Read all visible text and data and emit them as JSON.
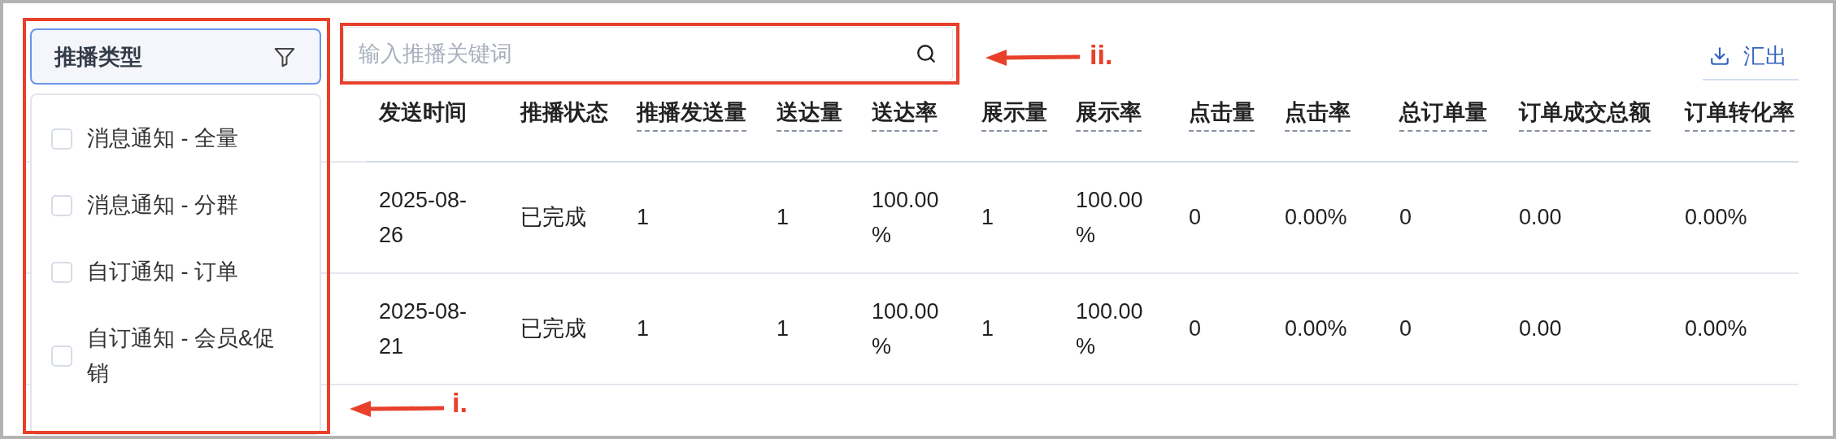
{
  "filter": {
    "title": "推播类型",
    "options": [
      {
        "label": "消息通知 - 全量",
        "checked": false
      },
      {
        "label": "消息通知 - 分群",
        "checked": false
      },
      {
        "label": "自订通知 - 订单",
        "checked": false
      },
      {
        "label": "自订通知 - 会员&促销",
        "checked": false
      }
    ]
  },
  "search": {
    "placeholder": "输入推播关键词"
  },
  "export_button": {
    "label": "汇出"
  },
  "table": {
    "columns": [
      {
        "label": "发送时间",
        "hint": false
      },
      {
        "label": "推播状态",
        "hint": false
      },
      {
        "label": "推播发送量",
        "hint": true
      },
      {
        "label": "送达量",
        "hint": true
      },
      {
        "label": "送达率",
        "hint": true
      },
      {
        "label": "展示量",
        "hint": true
      },
      {
        "label": "展示率",
        "hint": true
      },
      {
        "label": "点击量",
        "hint": true
      },
      {
        "label": "点击率",
        "hint": true
      },
      {
        "label": "总订单量",
        "hint": true
      },
      {
        "label": "订单成交总额",
        "hint": true
      },
      {
        "label": "订单转化率",
        "hint": true
      }
    ],
    "rows": [
      [
        "2025-08-26",
        "已完成",
        "1",
        "1",
        "100.00%",
        "1",
        "100.00%",
        "0",
        "0.00%",
        "0",
        "0.00",
        "0.00%"
      ],
      [
        "2025-08-21",
        "已完成",
        "1",
        "1",
        "100.00%",
        "1",
        "100.00%",
        "0",
        "0.00%",
        "0",
        "0.00",
        "0.00%"
      ]
    ]
  },
  "annotations": [
    {
      "label": "ii.",
      "kind": "search"
    },
    {
      "label": "i.",
      "kind": "filter"
    }
  ]
}
